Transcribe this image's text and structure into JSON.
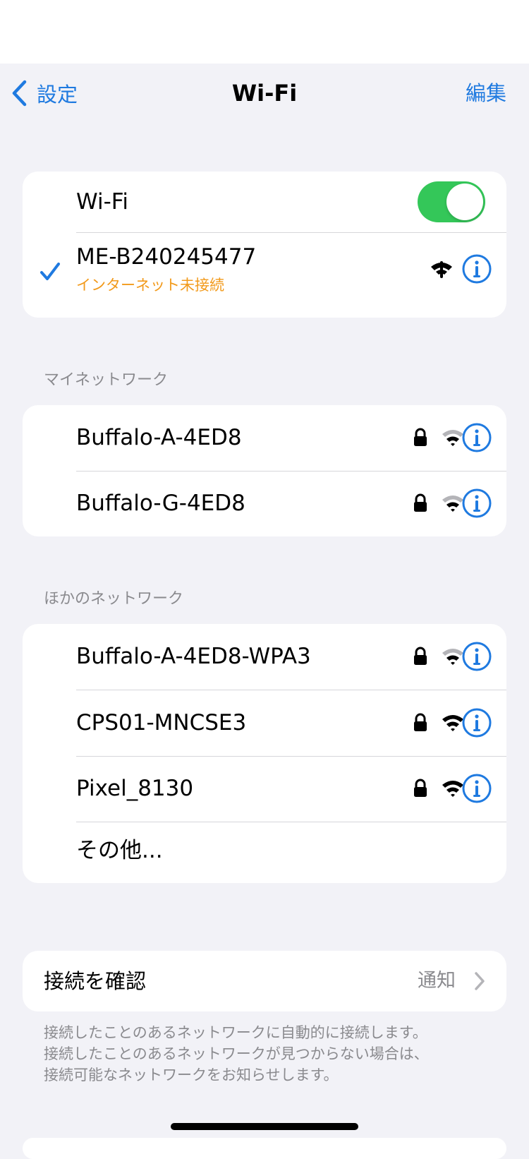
{
  "nav": {
    "back_label": "設定",
    "title": "Wi-Fi",
    "edit_label": "編集"
  },
  "wifi_group": {
    "wifi_label": "Wi-Fi",
    "wifi_enabled": true,
    "connected": {
      "name": "ME-B240245477",
      "status": "インターネット未接続"
    }
  },
  "my_networks": {
    "header": "マイネットワーク",
    "items": [
      {
        "name": "Buffalo-A-4ED8",
        "secured": true,
        "signal_bars": 2
      },
      {
        "name": "Buffalo-G-4ED8",
        "secured": true,
        "signal_bars": 2
      }
    ]
  },
  "other_networks": {
    "header": "ほかのネットワーク",
    "items": [
      {
        "name": "Buffalo-A-4ED8-WPA3",
        "secured": true,
        "signal_bars": 2
      },
      {
        "name": "CPS01-MNCSE3",
        "secured": true,
        "signal_bars": 3
      },
      {
        "name": "Pixel_8130",
        "secured": true,
        "signal_bars": 3
      }
    ],
    "other_label": "その他..."
  },
  "ask_to_join": {
    "label": "接続を確認",
    "value": "通知",
    "footnote_lines": [
      "接続したことのあるネットワークに自動的に接続します。",
      "接続したことのあるネットワークが見つからない場合は、",
      "接続可能なネットワークをお知らせします。"
    ]
  },
  "colors": {
    "accent": "#1f7ae0",
    "toggle_on": "#34c759",
    "warning": "#f29a1b",
    "background": "#f2f2f7",
    "secondary_text": "#8a8a8e"
  }
}
